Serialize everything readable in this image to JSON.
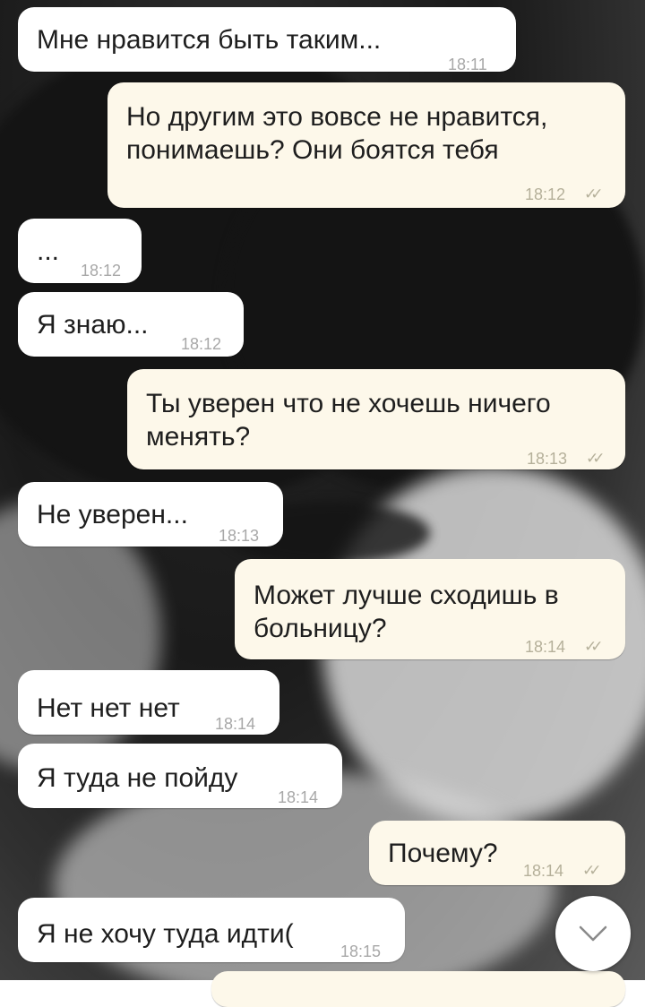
{
  "messages": [
    {
      "direction": "in",
      "text": "Мне нравится быть таким...",
      "time": "18:11"
    },
    {
      "direction": "out",
      "lines": [
        "Но другим это вовсе не нравится,",
        "понимаешь? Они боятся тебя"
      ],
      "time": "18:12",
      "status": "read"
    },
    {
      "direction": "in",
      "text": "...",
      "time": "18:12"
    },
    {
      "direction": "in",
      "text": "Я знаю...",
      "time": "18:12"
    },
    {
      "direction": "out",
      "lines": [
        "Ты уверен что не хочешь ничего",
        "менять?"
      ],
      "time": "18:13",
      "status": "read"
    },
    {
      "direction": "in",
      "text": "Не уверен...",
      "time": "18:13"
    },
    {
      "direction": "out",
      "lines": [
        "Может лучше сходишь в",
        "больницу?"
      ],
      "time": "18:14",
      "status": "read"
    },
    {
      "direction": "in",
      "text": "Нет нет нет",
      "time": "18:14"
    },
    {
      "direction": "in",
      "text": "Я туда не пойду",
      "time": "18:14"
    },
    {
      "direction": "out",
      "lines": [
        "Почему?"
      ],
      "time": "18:14",
      "status": "read"
    },
    {
      "direction": "in",
      "text": "Я не хочу туда идти(",
      "time": "18:15"
    }
  ],
  "scroll_button": {
    "icon": "chevron-down-icon"
  },
  "colors": {
    "incoming_bubble": "#ffffff",
    "outgoing_bubble": "#fdf8ea",
    "time_text": "#a8a8a8"
  }
}
